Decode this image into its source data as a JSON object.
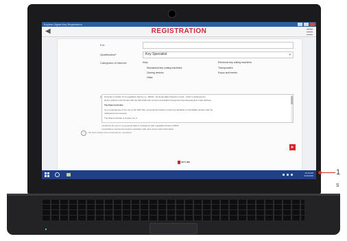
{
  "window": {
    "title": "Keyline Digital Key Registration",
    "accent_color": "#2a5fa0"
  },
  "app": {
    "title": "REGISTRATION",
    "title_color": "#d0273a",
    "back_icon": "back-arrow-icon",
    "menu_icon": "hamburger-menu-icon"
  },
  "form": {
    "fields": [
      {
        "label": "For:",
        "value": ""
      },
      {
        "label": "Qualification*",
        "value": "Key Specialist"
      },
      {
        "label": "Categories of interest:",
        "value": ""
      }
    ],
    "categories": [
      "Keys",
      "Mechanical key cutting machines",
      "Cloning devices",
      "Other",
      "Electronic key cutting machines",
      "Transponders",
      "Expos and events"
    ],
    "privacy_label": "Privacy:",
    "privacy_text": [
      "Pursuant to Article 13 of Legislative Decree no. 196/03 - Personal Data Protection Code - which is addressed to",
      "all the subjects who interact with the KEYLINE web services accessible through the http://www.keyline.it web address.",
      "The Data Controller",
      "As a consequence of the use of the Web Site, personal information concerning identified or identifiable people might be",
      "collected and processed.",
      "The Data Controller is Keyline S.p.A."
    ],
    "consents": [
      "I authorize the use of my personal data in compliance with Legislative Decree 196/03",
      "I would like to receive the Keyline newsletter with news and product information"
    ],
    "info_note": "The field marked with an asterisk are mandatory.",
    "info_icon": "info-icon",
    "next_icon": "chevron-right-icon",
    "next_color": "#d62a2a"
  },
  "brand": {
    "logo_text": "KEYLINE"
  },
  "taskbar": {
    "start_icon": "windows-start-icon",
    "search_icon": "search-icon",
    "folder_icon": "file-explorer-icon",
    "time": "10:16 AM",
    "date": "6/30/2015"
  },
  "callout": {
    "line1": "1",
    "line2": "s"
  }
}
